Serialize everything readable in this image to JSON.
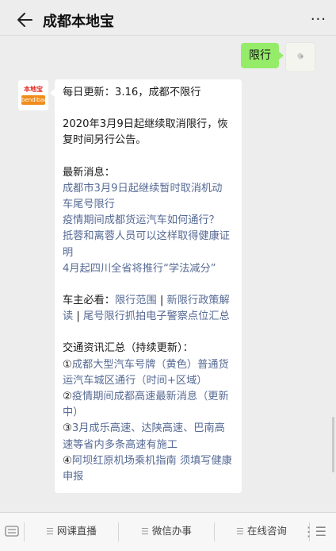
{
  "header": {
    "title": "成都本地宝",
    "more": "···"
  },
  "messages": {
    "user_text": "限行",
    "bot_avatar_logo_top": "本地宝",
    "bot_avatar_logo_bottom": "bendibao",
    "bot": {
      "line1": "每日更新：3.16，成都不限行",
      "line2": "2020年3月9日起继续取消限行，恢复时间另行公告。",
      "news_heading": "最新消息：",
      "news_links": [
        "成都市3月9日起继续暂时取消机动车尾号限行",
        "疫情期间成都货运汽车如何通行？",
        "抵蓉和离蓉人员可以这样取得健康证明",
        "4月起四川全省将推行“学法减分”"
      ],
      "owner_prefix": "车主必看：",
      "owner_links": [
        "限行范围",
        "新限行政策解读",
        "尾号限行抓拍电子警察点位汇总"
      ],
      "owner_sep": "|",
      "traffic_heading": "交通资讯汇总（持续更新）：",
      "traffic_items": [
        {
          "num": "①",
          "text": "成都大型汽车号牌（黄色）普通货运汽车城区通行（时间+区域）"
        },
        {
          "num": "②",
          "text": "疫情期间成都高速最新消息（更新中）"
        },
        {
          "num": "③",
          "text": "3月成乐高速、达陕高速、巴南高速等省内多条高速有施工"
        },
        {
          "num": "④",
          "text": "阿坝红原机场乘机指南 须填写健康申报"
        }
      ]
    }
  },
  "bottom_menu": {
    "items": [
      "网课直播",
      "微信办事",
      "在线咨询"
    ],
    "ham": "☰",
    "more": "⋮☰"
  }
}
